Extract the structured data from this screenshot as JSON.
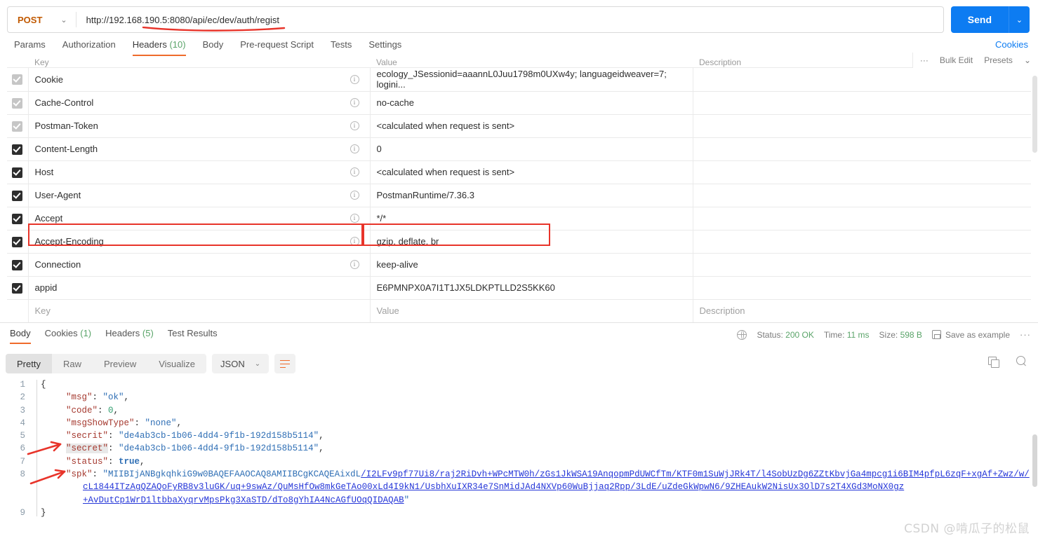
{
  "request": {
    "method": "POST",
    "method_caret": "⌄",
    "url": "http://192.168.190.5:8080/api/ec/dev/auth/regist",
    "send_label": "Send",
    "send_caret": "⌄",
    "tabs": [
      {
        "label": "Params",
        "active": false
      },
      {
        "label": "Authorization",
        "active": false
      },
      {
        "label": "Headers",
        "count": "(10)",
        "active": true
      },
      {
        "label": "Body",
        "active": false
      },
      {
        "label": "Pre-request Script",
        "active": false
      },
      {
        "label": "Tests",
        "active": false
      },
      {
        "label": "Settings",
        "active": false
      }
    ],
    "cookies_link": "Cookies"
  },
  "headers_table": {
    "columns": {
      "key": "Key",
      "value": "Value",
      "description": "Description"
    },
    "bulk_edit": "Bulk Edit",
    "presets": "Presets",
    "presets_caret": "⌄",
    "dots": "···",
    "rows": [
      {
        "checked": "dim",
        "key": "Cookie",
        "value": "ecology_JSessionid=aaannL0Juu1798m0UXw4y; languageidweaver=7; logini...",
        "description": ""
      },
      {
        "checked": "dim",
        "key": "Cache-Control",
        "value": "no-cache",
        "description": ""
      },
      {
        "checked": "dim",
        "key": "Postman-Token",
        "value": "<calculated when request is sent>",
        "description": ""
      },
      {
        "checked": "on",
        "key": "Content-Length",
        "value": "0",
        "description": ""
      },
      {
        "checked": "on",
        "key": "Host",
        "value": "<calculated when request is sent>",
        "description": ""
      },
      {
        "checked": "on",
        "key": "User-Agent",
        "value": "PostmanRuntime/7.36.3",
        "description": ""
      },
      {
        "checked": "on",
        "key": "Accept",
        "value": "*/*",
        "description": ""
      },
      {
        "checked": "on",
        "key": "Accept-Encoding",
        "value": "gzip, deflate, br",
        "description": ""
      },
      {
        "checked": "on",
        "key": "Connection",
        "value": "keep-alive",
        "description": ""
      },
      {
        "checked": "on",
        "key": "appid",
        "value": "E6PMNPX0A7I1T1JX5LDKPTLLD2S5KK60",
        "description": "",
        "highlighted": true
      }
    ],
    "placeholder_row": {
      "key": "Key",
      "value": "Value",
      "description": "Description"
    }
  },
  "response": {
    "tabs": [
      {
        "label": "Body",
        "active": true
      },
      {
        "label": "Cookies",
        "count": "(1)",
        "active": false
      },
      {
        "label": "Headers",
        "count": "(5)",
        "active": false
      },
      {
        "label": "Test Results",
        "active": false
      }
    ],
    "status_label": "Status:",
    "status_value": "200 OK",
    "time_label": "Time:",
    "time_value": "11 ms",
    "size_label": "Size:",
    "size_value": "598 B",
    "save_as_example": "Save as example",
    "more_dots": "···",
    "view_modes": [
      {
        "label": "Pretty",
        "active": true
      },
      {
        "label": "Raw",
        "active": false
      },
      {
        "label": "Preview",
        "active": false
      },
      {
        "label": "Visualize",
        "active": false
      }
    ],
    "format": "JSON",
    "format_caret": "⌄"
  },
  "body_json": {
    "line_numbers": [
      "1",
      "2",
      "3",
      "4",
      "5",
      "6",
      "7",
      "8",
      "9"
    ],
    "open_brace": "{",
    "close_brace": "}",
    "fields": [
      {
        "key": "\"msg\"",
        "colon": ": ",
        "value": "\"ok\"",
        "type": "string",
        "comma": ","
      },
      {
        "key": "\"code\"",
        "colon": ": ",
        "value": "0",
        "type": "number",
        "comma": ","
      },
      {
        "key": "\"msgShowType\"",
        "colon": ": ",
        "value": "\"none\"",
        "type": "string",
        "comma": ","
      },
      {
        "key": "\"secrit\"",
        "colon": ": ",
        "value": "\"de4ab3cb-1b06-4dd4-9f1b-192d158b5114\"",
        "type": "string",
        "comma": ","
      },
      {
        "key": "\"secret\"",
        "colon": ": ",
        "value": "\"de4ab3cb-1b06-4dd4-9f1b-192d158b5114\"",
        "type": "string",
        "comma": ",",
        "highlight": true
      },
      {
        "key": "\"status\"",
        "colon": ": ",
        "value": "true",
        "type": "boolean",
        "comma": ","
      },
      {
        "key": "\"spk\"",
        "colon": ": ",
        "type": "link_string"
      }
    ],
    "spk_prefix": "\"MIIBIjANBgkqhkiG9w0BAQEFAAOCAQ8AMIIBCgKCAQEAixdL",
    "spk_link_line1": "/I2LFv9pf77Ui8/raj2RiDvh+WPcMTW0h/zGs1JkWSA19AnqopmPdUWCfTm/KTF0m1SuWjJRk4T/l4SobUzDg6ZZtKbvjGa4mpcg1i6BIM4pfpL6zqF+xgAf+Zwz/w/",
    "spk_link_line2": "cL1844ITzAgQZAQoFyRB8v3luGK/uq+9swAz/QuMsHfOw8mkGeTAo00xLd4I9kN1/UsbhXuIXR34e7SnMidJAd4NXVp60WuBjjaq2Rpp/3LdE/uZdeGkWpwN6/9ZHEAukW2NisUx3OlD7s2T4XGd3MoNX0gz",
    "spk_link_line3": "+AvDutCp1WrD1ltbbaXyqrvMpsPkg3XaSTD/dTo8gYhIA4NcAGfUOqQIDAQAB",
    "spk_close_quote": "\""
  },
  "watermark": "CSDN @啃瓜子的松鼠",
  "colors": {
    "accent_orange": "#ef6b2b",
    "send_blue": "#0d7cf2",
    "annotation_red": "#e8342a",
    "link_blue": "#2536d8",
    "status_green": "#5aa469"
  }
}
